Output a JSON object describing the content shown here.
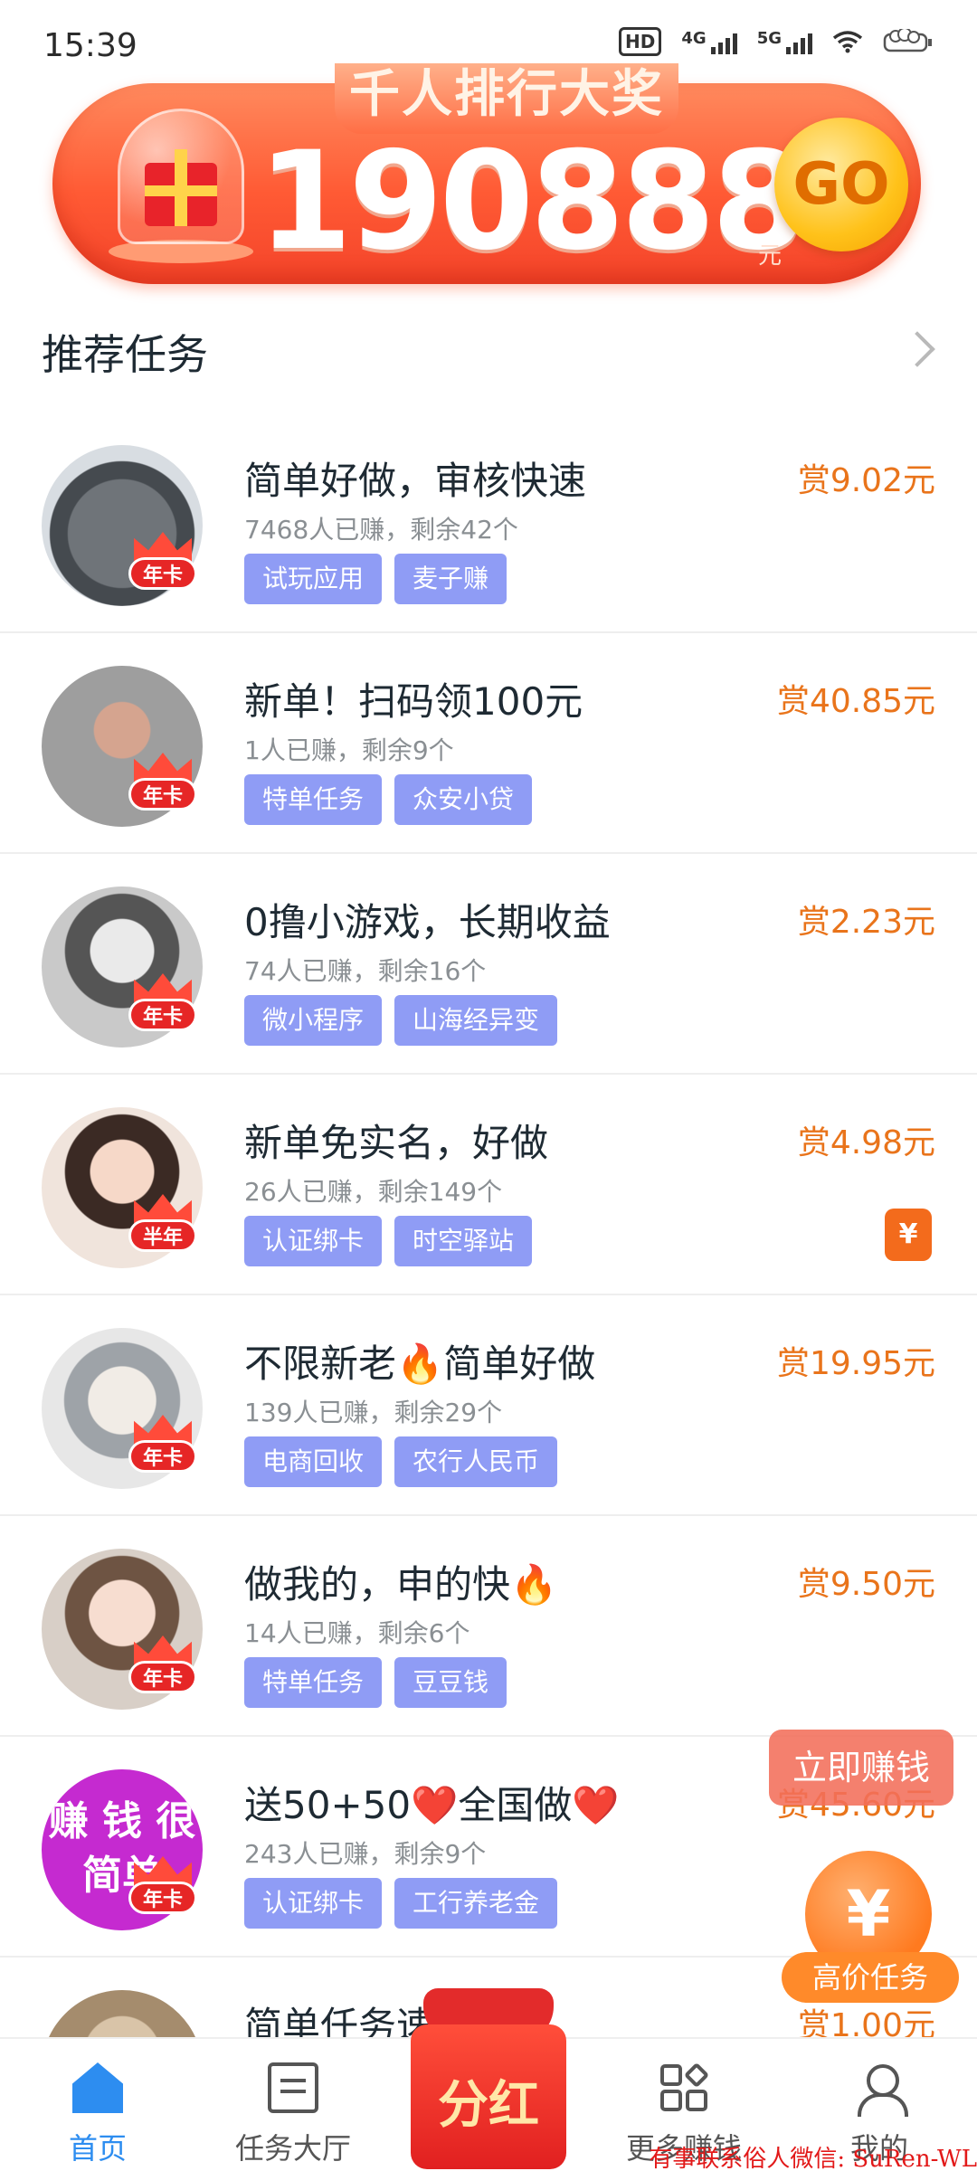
{
  "status_bar": {
    "time": "15:39",
    "hd": "HD",
    "net1": "4G",
    "net2": "5G"
  },
  "banner": {
    "title": "千人排行大奖",
    "amount": "190888",
    "unit": "元",
    "go": "GO"
  },
  "section": {
    "title": "推荐任务"
  },
  "tasks": [
    {
      "title": "简单好做，审核快速",
      "meta": "7468人已赚，剩余42个",
      "reward": "赏9.02元",
      "tags": [
        "试玩应用",
        "麦子赚"
      ],
      "badge": "年卡",
      "avatar_text": ""
    },
    {
      "title": "新单！扫码领100元",
      "meta": "1人已赚，剩余9个",
      "reward": "赏40.85元",
      "tags": [
        "特单任务",
        "众安小贷"
      ],
      "badge": "年卡",
      "avatar_text": ""
    },
    {
      "title": "0撸小游戏，长期收益",
      "meta": "74人已赚，剩余16个",
      "reward": "赏2.23元",
      "tags": [
        "微小程序",
        "山海经异变"
      ],
      "badge": "年卡",
      "avatar_text": ""
    },
    {
      "title": "新单免实名，好做",
      "meta": "26人已赚，剩余149个",
      "reward": "赏4.98元",
      "tags": [
        "认证绑卡",
        "时空驿站"
      ],
      "badge": "半年",
      "avatar_text": "",
      "yen": "¥"
    },
    {
      "title": "不限新老🔥简单好做",
      "meta": "139人已赚，剩余29个",
      "reward": "赏19.95元",
      "tags": [
        "电商回收",
        "农行人民币"
      ],
      "badge": "年卡",
      "avatar_text": ""
    },
    {
      "title": "做我的，申的快🔥",
      "meta": "14人已赚，剩余6个",
      "reward": "赏9.50元",
      "tags": [
        "特单任务",
        "豆豆钱"
      ],
      "badge": "年卡",
      "avatar_text": ""
    },
    {
      "title": "送50+50❤️全国做❤️",
      "meta": "243人已赚，剩余9个",
      "reward": "赏45.60元",
      "tags": [
        "认证绑卡",
        "工行养老金"
      ],
      "badge": "年卡",
      "avatar_text": "赚 钱 很简单"
    },
    {
      "title": "简单任务速",
      "meta": "",
      "reward": "赏1.00元",
      "tags": [],
      "badge": "",
      "avatar_text": ""
    }
  ],
  "floating": {
    "earn_now": "立即赚钱",
    "high_price": "高价任务",
    "coin": "¥"
  },
  "nav": {
    "home": "首页",
    "hall": "任务大厅",
    "dividend": "分红",
    "more": "更多赚钱",
    "mine": "我的"
  },
  "watermark": "有事联系俗人微信: SuRen-WL"
}
